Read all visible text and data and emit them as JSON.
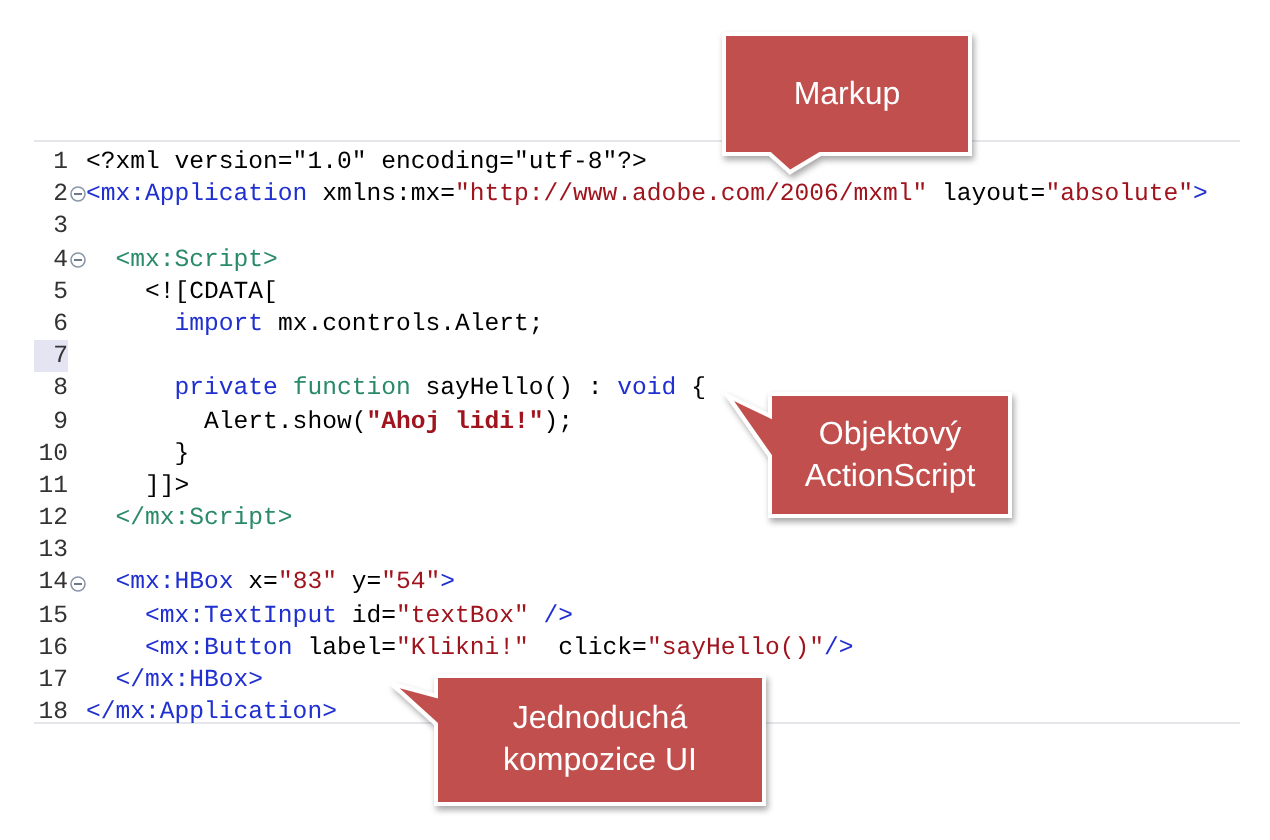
{
  "editor": {
    "lines": [
      {
        "number": "1",
        "fold": false,
        "current": false,
        "tokens": [
          {
            "kind": "plain",
            "text": "<?xml version=\"1.0\" encoding=\"utf-8\"?>"
          }
        ]
      },
      {
        "number": "2",
        "fold": true,
        "current": false,
        "tokens": [
          {
            "kind": "tag",
            "text": "<mx:Application"
          },
          {
            "kind": "plain",
            "text": " xmlns:mx="
          },
          {
            "kind": "string",
            "text": "\"http://www.adobe.com/2006/mxml\""
          },
          {
            "kind": "plain",
            "text": " layout="
          },
          {
            "kind": "string",
            "text": "\"absolute\""
          },
          {
            "kind": "tag",
            "text": ">"
          }
        ]
      },
      {
        "number": "3",
        "fold": false,
        "current": false
      },
      {
        "number": "4",
        "fold": true,
        "current": false,
        "tokens": [
          {
            "kind": "script",
            "text": "  <mx:Script>"
          }
        ]
      },
      {
        "number": "5",
        "fold": false,
        "current": false,
        "tokens": [
          {
            "kind": "plain",
            "text": "    <![CDATA["
          }
        ]
      },
      {
        "number": "6",
        "fold": false,
        "current": false,
        "tokens": [
          {
            "kind": "keyword",
            "text": "      import"
          },
          {
            "kind": "plain",
            "text": " mx.controls.Alert;"
          }
        ]
      },
      {
        "number": "7",
        "fold": false,
        "current": true
      },
      {
        "number": "8",
        "fold": false,
        "current": false,
        "tokens": [
          {
            "kind": "keyword",
            "text": "      private"
          },
          {
            "kind": "declaration",
            "text": " function"
          },
          {
            "kind": "plain",
            "text": " sayHello() : "
          },
          {
            "kind": "keyword",
            "text": "void"
          },
          {
            "kind": "plain",
            "text": " {"
          }
        ]
      },
      {
        "number": "9",
        "fold": false,
        "current": false,
        "tokens": [
          {
            "kind": "plain",
            "text": "        Alert.show("
          },
          {
            "kind": "literal",
            "text": "\"Ahoj lidi!\""
          },
          {
            "kind": "plain",
            "text": ");"
          }
        ]
      },
      {
        "number": "10",
        "fold": false,
        "current": false,
        "tokens": [
          {
            "kind": "plain",
            "text": "      }"
          }
        ]
      },
      {
        "number": "11",
        "fold": false,
        "current": false,
        "tokens": [
          {
            "kind": "plain",
            "text": "    ]]>"
          }
        ]
      },
      {
        "number": "12",
        "fold": false,
        "current": false,
        "tokens": [
          {
            "kind": "script",
            "text": "  </mx:Script>"
          }
        ]
      },
      {
        "number": "13",
        "fold": false,
        "current": false
      },
      {
        "number": "14",
        "fold": true,
        "current": false,
        "tokens": [
          {
            "kind": "tag",
            "text": "  <mx:HBox"
          },
          {
            "kind": "plain",
            "text": " x="
          },
          {
            "kind": "string",
            "text": "\"83\""
          },
          {
            "kind": "plain",
            "text": " y="
          },
          {
            "kind": "string",
            "text": "\"54\""
          },
          {
            "kind": "tag",
            "text": ">"
          }
        ]
      },
      {
        "number": "15",
        "fold": false,
        "current": false,
        "tokens": [
          {
            "kind": "tag",
            "text": "    <mx:TextInput"
          },
          {
            "kind": "plain",
            "text": " id="
          },
          {
            "kind": "string",
            "text": "\"textBox\""
          },
          {
            "kind": "tag",
            "text": " />"
          }
        ]
      },
      {
        "number": "16",
        "fold": false,
        "current": false,
        "tokens": [
          {
            "kind": "tag",
            "text": "    <mx:Button"
          },
          {
            "kind": "plain",
            "text": " label="
          },
          {
            "kind": "string",
            "text": "\"Klikni!\""
          },
          {
            "kind": "plain",
            "text": "  click="
          },
          {
            "kind": "string",
            "text": "\"sayHello()\""
          },
          {
            "kind": "tag",
            "text": "/>"
          }
        ]
      },
      {
        "number": "17",
        "fold": false,
        "current": false,
        "tokens": [
          {
            "kind": "tag",
            "text": "  </mx:HBox>"
          }
        ]
      },
      {
        "number": "18",
        "fold": false,
        "current": false,
        "tokens": [
          {
            "kind": "tag",
            "text": "</mx:Application>"
          }
        ]
      }
    ]
  },
  "callouts": [
    {
      "text": "Markup"
    },
    {
      "text": "Objektový ActionScript"
    },
    {
      "text": "Jednoduchá kompozice UI"
    }
  ]
}
